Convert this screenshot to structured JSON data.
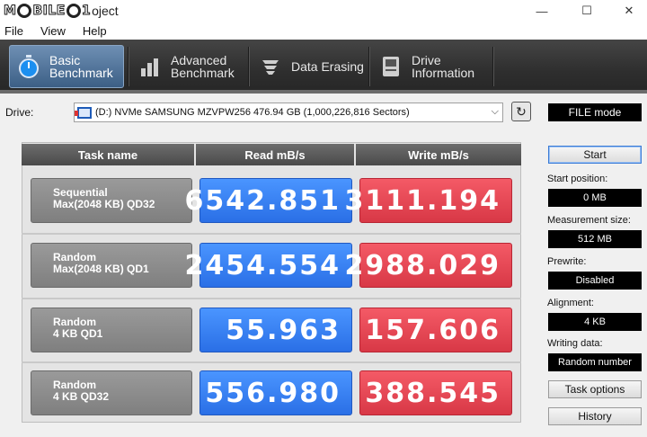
{
  "window": {
    "logo_prefix": "M",
    "logo_mid": "BILE",
    "logo_suffix": "1",
    "title": "oject",
    "minimize": "—",
    "maximize": "☐",
    "close": "✕"
  },
  "menu": [
    {
      "label": "File"
    },
    {
      "label": "View"
    },
    {
      "label": "Help"
    }
  ],
  "tabs": [
    {
      "line1": "Basic",
      "line2": "Benchmark",
      "active": true
    },
    {
      "line1": "Advanced",
      "line2": "Benchmark",
      "active": false
    },
    {
      "line1": "Data Erasing",
      "line2": "",
      "active": false
    },
    {
      "line1": "Drive",
      "line2": "Information",
      "active": false
    }
  ],
  "drive": {
    "label": "Drive:",
    "selected": "(D:) NVMe SAMSUNG MZVPW256  476.94 GB (1,000,226,816 Sectors)",
    "mode": "FILE mode"
  },
  "table": {
    "headers": [
      "Task name",
      "Read mB/s",
      "Write mB/s"
    ],
    "rows": [
      {
        "task_line1": "Sequential",
        "task_line2": "Max(2048 KB) QD32",
        "read": "6542.851",
        "write": "3111.194"
      },
      {
        "task_line1": "Random",
        "task_line2": "Max(2048 KB) QD1",
        "read": "2454.554",
        "write": "2988.029"
      },
      {
        "task_line1": "Random",
        "task_line2": "4 KB QD1",
        "read": "55.963",
        "write": "157.606"
      },
      {
        "task_line1": "Random",
        "task_line2": "4 KB QD32",
        "read": "556.980",
        "write": "388.545"
      }
    ]
  },
  "side": {
    "start_label": "Start",
    "start_position_label": "Start position:",
    "start_position_value": "0 MB",
    "measurement_size_label": "Measurement size:",
    "measurement_size_value": "512 MB",
    "prewrite_label": "Prewrite:",
    "prewrite_value": "Disabled",
    "alignment_label": "Alignment:",
    "alignment_value": "4 KB",
    "writing_data_label": "Writing data:",
    "writing_data_value": "Random number",
    "task_options_label": "Task options",
    "history_label": "History"
  },
  "colors": {
    "read": "#2f7ff0",
    "write": "#e34452",
    "active_tab": "#4f739c"
  }
}
